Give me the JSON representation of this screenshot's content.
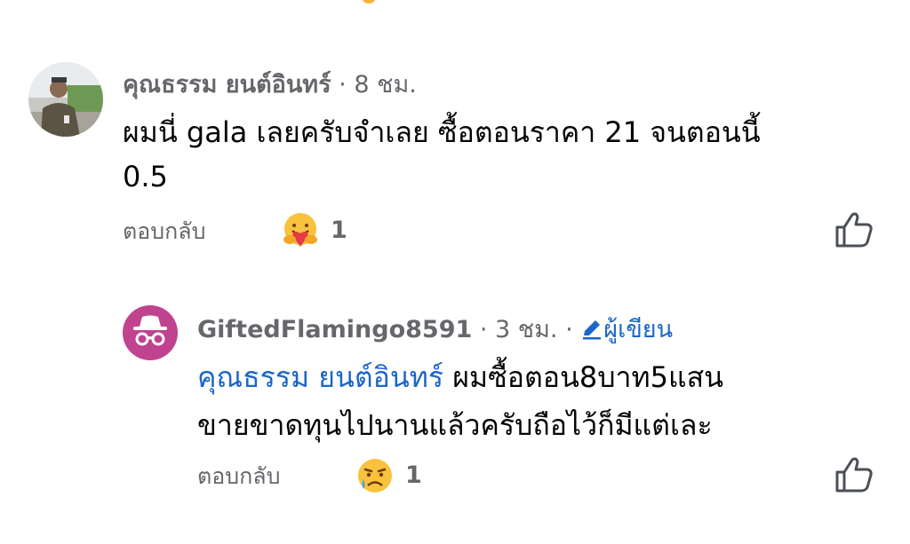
{
  "comments": [
    {
      "author": "คุณธรรม ยนต์อินทร์",
      "separator": "·",
      "time": "8 ชม.",
      "body_lines": [
        "ผมนี่ gala เลยครับจำเลย ซื้อตอนราคา 21 จนตอนนี้",
        "0.5"
      ],
      "reply_label": "ตอบกลับ",
      "reaction_icon": "hug-emoji-icon",
      "reaction_count": "1"
    },
    {
      "author": "GiftedFlamingo8591",
      "separator": "·",
      "time": "3 ชม.",
      "separator2": "·",
      "author_badge": "ผู้เขียน",
      "mention": "คุณธรรม ยนต์อินทร์",
      "body_line1_rest": " ผมซื้อตอน8บาท5แสน",
      "body_line2": "ขายขาดทุนไปนานแล้วครับถือไว้ก็มีแต่เละ",
      "reply_label": "ตอบกลับ",
      "reaction_icon": "sad-emoji-icon",
      "reaction_count": "1"
    }
  ],
  "colors": {
    "mention": "#1b66c9",
    "secondary_text": "#65676b",
    "anon_avatar_bg": "#c0438f"
  }
}
